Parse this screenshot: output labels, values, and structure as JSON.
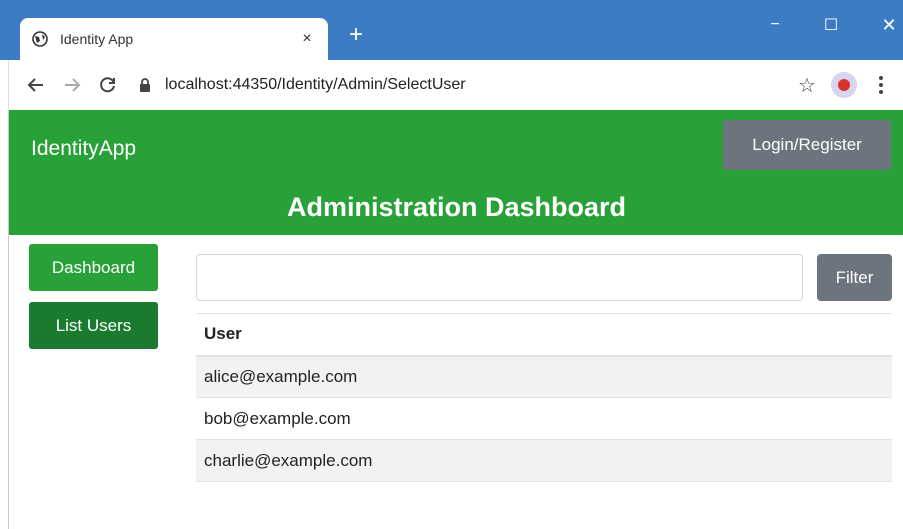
{
  "browser": {
    "tab_title": "Identity App",
    "tab_close": "×",
    "new_tab": "+",
    "url": "localhost:44350/Identity/Admin/SelectUser",
    "window_controls": {
      "minimize": "−",
      "maximize": "☐",
      "close": "✕"
    }
  },
  "header": {
    "brand": "IdentityApp",
    "login_label": "Login/Register",
    "title": "Administration Dashboard"
  },
  "sidebar": {
    "items": [
      {
        "label": "Dashboard"
      },
      {
        "label": "List Users"
      }
    ]
  },
  "filter": {
    "value": "",
    "button_label": "Filter"
  },
  "table": {
    "header": "User",
    "rows": [
      "alice@example.com",
      "bob@example.com",
      "charlie@example.com"
    ]
  },
  "colors": {
    "chrome_blue": "#3c7cc4",
    "header_green": "#28a139",
    "active_green": "#1a7a2e",
    "secondary_gray": "#6c757d"
  }
}
